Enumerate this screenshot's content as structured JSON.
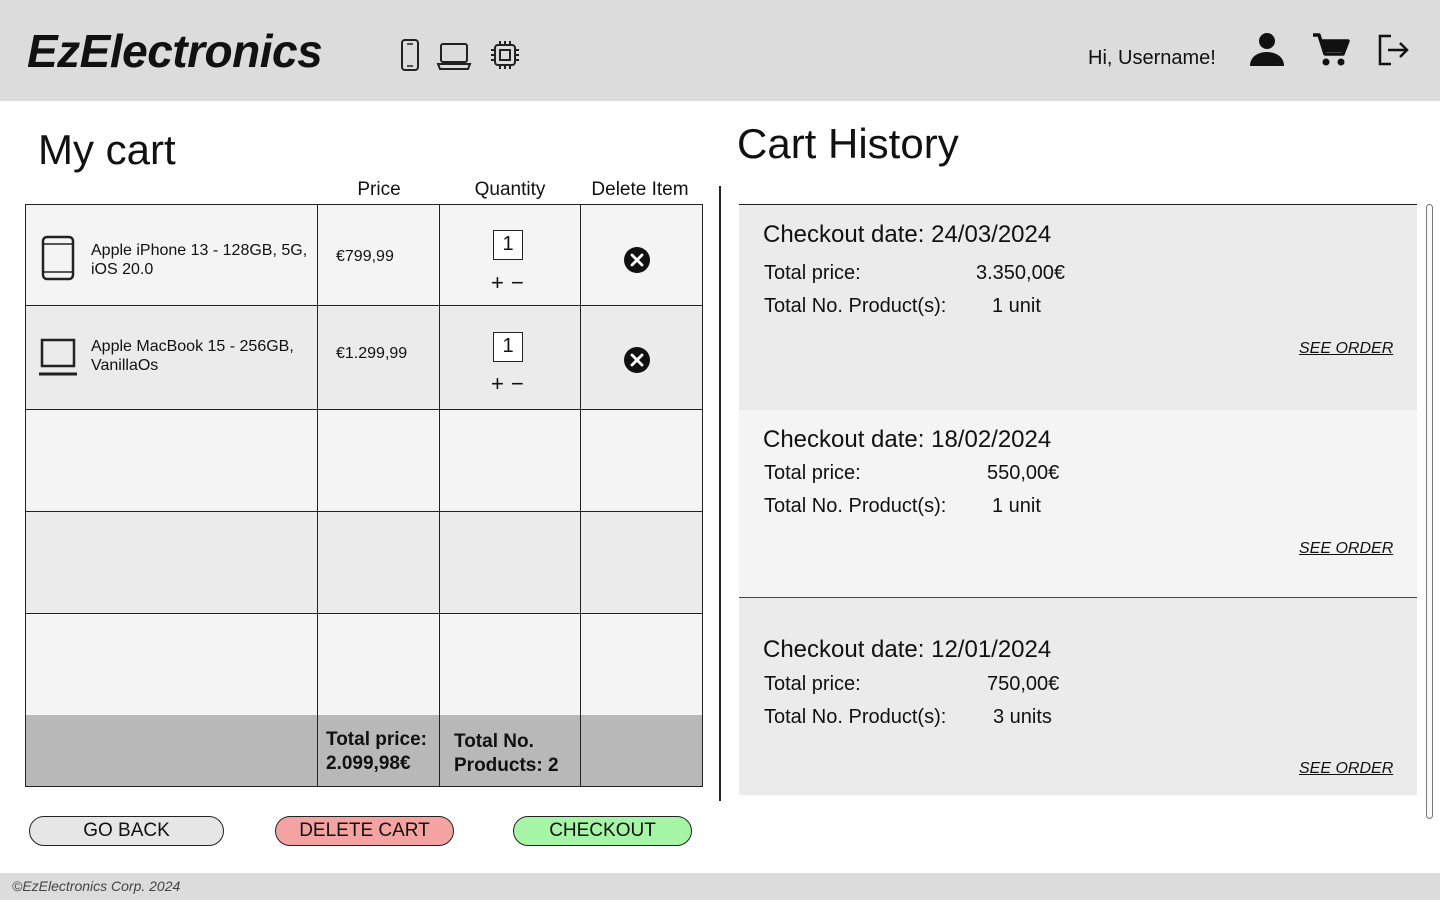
{
  "header": {
    "brand": "EzElectronics",
    "categories": [
      "smartphone-icon",
      "laptop-icon",
      "chip-icon"
    ],
    "greeting": "Hi, Username!",
    "icons": [
      "user-icon",
      "cart-icon",
      "logout-icon"
    ]
  },
  "cart": {
    "title": "My cart",
    "columns": {
      "price": "Price",
      "quantity": "Quantity",
      "delete": "Delete Item"
    },
    "items": [
      {
        "name": "Apple iPhone 13 - 128GB, 5G, iOS 20.0",
        "price": "€799,99",
        "qty": "1",
        "icon": "smartphone-icon"
      },
      {
        "name": "Apple MacBook 15 - 256GB, VanillaOs",
        "price": "€1.299,99",
        "qty": "1",
        "icon": "laptop-icon"
      }
    ],
    "plus": "+",
    "minus": "−",
    "total_price_label": "Total price:",
    "total_price_value": "2.099,98€",
    "total_products_line1": "Total No.",
    "total_products_line2": "Products: 2"
  },
  "buttons": {
    "go_back": "GO BACK",
    "delete_cart": "DELETE CART",
    "checkout": "CHECKOUT"
  },
  "colors": {
    "header_bg": "#dcdcdc",
    "delete_cart": "#f4a3a3",
    "checkout": "#a6f5a6",
    "go_back": "#e6e6e6",
    "totals_row": "#b8b8b8"
  },
  "history": {
    "title": "Cart History",
    "total_price_label": "Total price:",
    "total_products_label": "Total No. Product(s):",
    "see_order": "SEE ORDER",
    "orders": [
      {
        "date": "Checkout date: 24/03/2024",
        "total_price": "3.350,00€",
        "products": "1 unit"
      },
      {
        "date": "Checkout date: 18/02/2024",
        "total_price": "550,00€",
        "products": "1 unit"
      },
      {
        "date": "Checkout date: 12/01/2024",
        "total_price": "750,00€",
        "products": "3 units"
      }
    ]
  },
  "footer": {
    "text": "©EzElectronics Corp. 2024"
  }
}
